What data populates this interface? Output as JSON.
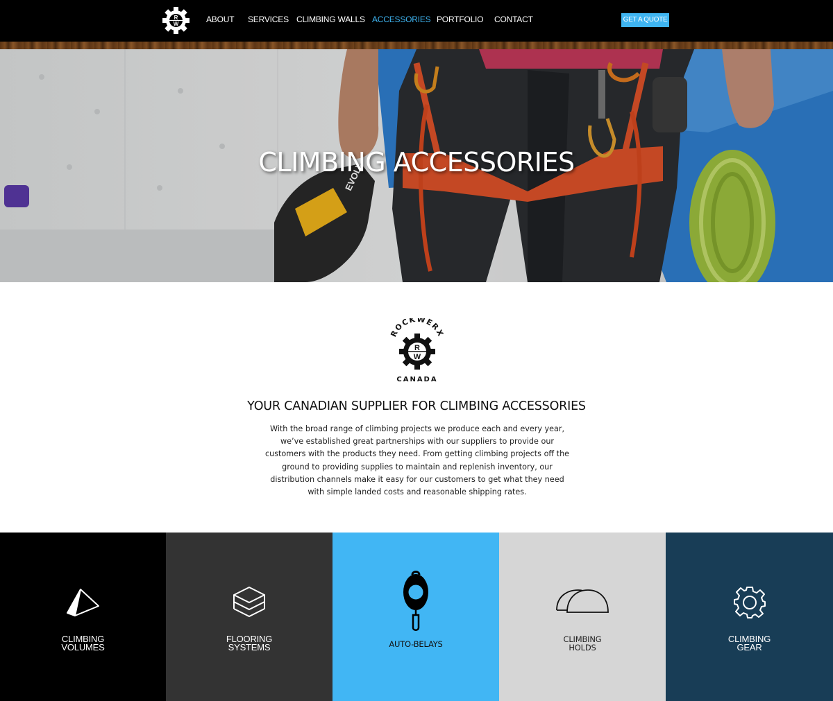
{
  "header": {
    "logo": {
      "letters_top": "R",
      "letters_bottom": "W"
    },
    "nav": [
      {
        "label": "ABOUT",
        "active": false
      },
      {
        "label": "SERVICES",
        "active": false
      },
      {
        "label": "CLIMBING WALLS",
        "active": false
      },
      {
        "label": "ACCESSORIES",
        "active": true
      },
      {
        "label": "PORTFOLIO",
        "active": false
      },
      {
        "label": "CONTACT",
        "active": false
      }
    ],
    "cta_label": "GET A QUOTE"
  },
  "hero": {
    "title": "CLIMBING ACCESSORIES",
    "shoe_brand": "EVOLV"
  },
  "intro": {
    "logo": {
      "arc_text": "ROCKWERX",
      "bottom_text": "CANADA",
      "letters_top": "R",
      "letters_bottom": "W"
    },
    "heading": "YOUR CANADIAN SUPPLIER FOR CLIMBING ACCESSORIES",
    "body": "With the broad range of climbing projects we produce each and every year, we’ve established great partnerships with our suppliers to provide our customers with the products they need. From getting climbing projects off the ground to providing supplies to maintain and replenish inventory, our distribution channels make it easy for our customers to get what they need with simple landed costs and reasonable shipping rates."
  },
  "categories": [
    {
      "label": "CLIMBING\nVOLUMES",
      "icon": "volume-icon",
      "background": "#000000",
      "text_color": "#ffffff"
    },
    {
      "label": "FLOORING\nSYSTEMS",
      "icon": "layers-icon",
      "background": "#333333",
      "text_color": "#ffffff"
    },
    {
      "label": "AUTO-BELAYS",
      "icon": "auto-belay-icon",
      "background": "#41b6f4",
      "text_color": "#111111"
    },
    {
      "label": "CLIMBING\nHOLDS",
      "icon": "climbing-holds-icon",
      "background": "#d6d6d6",
      "text_color": "#222222"
    },
    {
      "label": "CLIMBING\nGEAR",
      "icon": "gear-icon",
      "background": "#183d56",
      "text_color": "#ffffff"
    }
  ],
  "colors": {
    "accent": "#3fb5f2",
    "header_bg": "#000000"
  }
}
